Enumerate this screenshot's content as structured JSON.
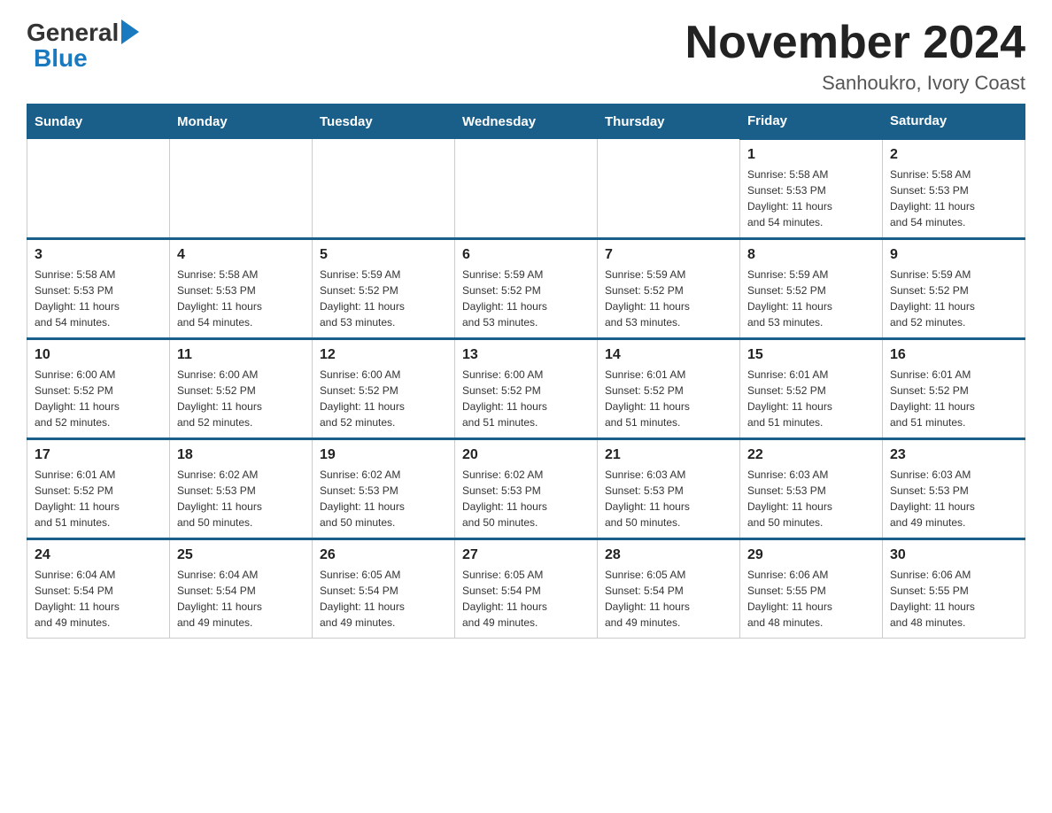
{
  "logo": {
    "general": "General",
    "blue": "Blue",
    "triangle_color": "#1a7abf"
  },
  "header": {
    "title": "November 2024",
    "subtitle": "Sanhoukro, Ivory Coast"
  },
  "weekdays": [
    "Sunday",
    "Monday",
    "Tuesday",
    "Wednesday",
    "Thursday",
    "Friday",
    "Saturday"
  ],
  "weeks": [
    [
      {
        "day": "",
        "info": ""
      },
      {
        "day": "",
        "info": ""
      },
      {
        "day": "",
        "info": ""
      },
      {
        "day": "",
        "info": ""
      },
      {
        "day": "",
        "info": ""
      },
      {
        "day": "1",
        "info": "Sunrise: 5:58 AM\nSunset: 5:53 PM\nDaylight: 11 hours\nand 54 minutes."
      },
      {
        "day": "2",
        "info": "Sunrise: 5:58 AM\nSunset: 5:53 PM\nDaylight: 11 hours\nand 54 minutes."
      }
    ],
    [
      {
        "day": "3",
        "info": "Sunrise: 5:58 AM\nSunset: 5:53 PM\nDaylight: 11 hours\nand 54 minutes."
      },
      {
        "day": "4",
        "info": "Sunrise: 5:58 AM\nSunset: 5:53 PM\nDaylight: 11 hours\nand 54 minutes."
      },
      {
        "day": "5",
        "info": "Sunrise: 5:59 AM\nSunset: 5:52 PM\nDaylight: 11 hours\nand 53 minutes."
      },
      {
        "day": "6",
        "info": "Sunrise: 5:59 AM\nSunset: 5:52 PM\nDaylight: 11 hours\nand 53 minutes."
      },
      {
        "day": "7",
        "info": "Sunrise: 5:59 AM\nSunset: 5:52 PM\nDaylight: 11 hours\nand 53 minutes."
      },
      {
        "day": "8",
        "info": "Sunrise: 5:59 AM\nSunset: 5:52 PM\nDaylight: 11 hours\nand 53 minutes."
      },
      {
        "day": "9",
        "info": "Sunrise: 5:59 AM\nSunset: 5:52 PM\nDaylight: 11 hours\nand 52 minutes."
      }
    ],
    [
      {
        "day": "10",
        "info": "Sunrise: 6:00 AM\nSunset: 5:52 PM\nDaylight: 11 hours\nand 52 minutes."
      },
      {
        "day": "11",
        "info": "Sunrise: 6:00 AM\nSunset: 5:52 PM\nDaylight: 11 hours\nand 52 minutes."
      },
      {
        "day": "12",
        "info": "Sunrise: 6:00 AM\nSunset: 5:52 PM\nDaylight: 11 hours\nand 52 minutes."
      },
      {
        "day": "13",
        "info": "Sunrise: 6:00 AM\nSunset: 5:52 PM\nDaylight: 11 hours\nand 51 minutes."
      },
      {
        "day": "14",
        "info": "Sunrise: 6:01 AM\nSunset: 5:52 PM\nDaylight: 11 hours\nand 51 minutes."
      },
      {
        "day": "15",
        "info": "Sunrise: 6:01 AM\nSunset: 5:52 PM\nDaylight: 11 hours\nand 51 minutes."
      },
      {
        "day": "16",
        "info": "Sunrise: 6:01 AM\nSunset: 5:52 PM\nDaylight: 11 hours\nand 51 minutes."
      }
    ],
    [
      {
        "day": "17",
        "info": "Sunrise: 6:01 AM\nSunset: 5:52 PM\nDaylight: 11 hours\nand 51 minutes."
      },
      {
        "day": "18",
        "info": "Sunrise: 6:02 AM\nSunset: 5:53 PM\nDaylight: 11 hours\nand 50 minutes."
      },
      {
        "day": "19",
        "info": "Sunrise: 6:02 AM\nSunset: 5:53 PM\nDaylight: 11 hours\nand 50 minutes."
      },
      {
        "day": "20",
        "info": "Sunrise: 6:02 AM\nSunset: 5:53 PM\nDaylight: 11 hours\nand 50 minutes."
      },
      {
        "day": "21",
        "info": "Sunrise: 6:03 AM\nSunset: 5:53 PM\nDaylight: 11 hours\nand 50 minutes."
      },
      {
        "day": "22",
        "info": "Sunrise: 6:03 AM\nSunset: 5:53 PM\nDaylight: 11 hours\nand 50 minutes."
      },
      {
        "day": "23",
        "info": "Sunrise: 6:03 AM\nSunset: 5:53 PM\nDaylight: 11 hours\nand 49 minutes."
      }
    ],
    [
      {
        "day": "24",
        "info": "Sunrise: 6:04 AM\nSunset: 5:54 PM\nDaylight: 11 hours\nand 49 minutes."
      },
      {
        "day": "25",
        "info": "Sunrise: 6:04 AM\nSunset: 5:54 PM\nDaylight: 11 hours\nand 49 minutes."
      },
      {
        "day": "26",
        "info": "Sunrise: 6:05 AM\nSunset: 5:54 PM\nDaylight: 11 hours\nand 49 minutes."
      },
      {
        "day": "27",
        "info": "Sunrise: 6:05 AM\nSunset: 5:54 PM\nDaylight: 11 hours\nand 49 minutes."
      },
      {
        "day": "28",
        "info": "Sunrise: 6:05 AM\nSunset: 5:54 PM\nDaylight: 11 hours\nand 49 minutes."
      },
      {
        "day": "29",
        "info": "Sunrise: 6:06 AM\nSunset: 5:55 PM\nDaylight: 11 hours\nand 48 minutes."
      },
      {
        "day": "30",
        "info": "Sunrise: 6:06 AM\nSunset: 5:55 PM\nDaylight: 11 hours\nand 48 minutes."
      }
    ]
  ]
}
